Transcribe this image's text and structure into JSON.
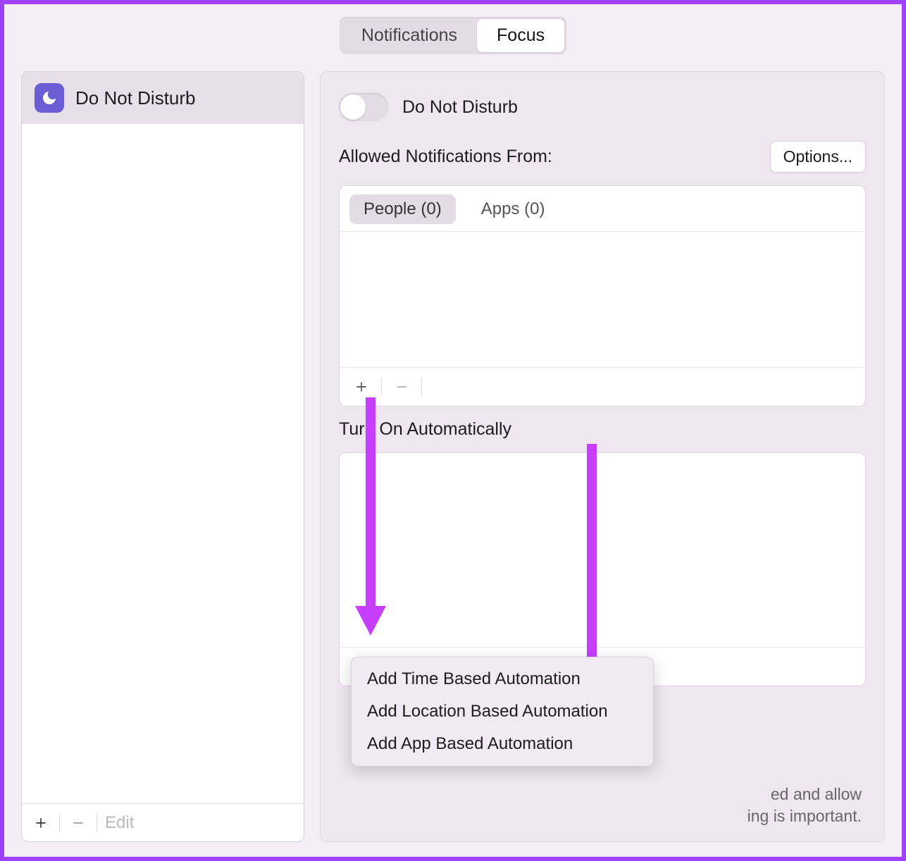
{
  "tabs": {
    "notifications": "Notifications",
    "focus": "Focus"
  },
  "sidebar": {
    "items": [
      {
        "label": "Do Not Disturb"
      }
    ],
    "edit": "Edit"
  },
  "main": {
    "dnd_label": "Do Not Disturb",
    "allowed": {
      "title": "Allowed Notifications From:",
      "options_btn": "Options...",
      "tabs": {
        "people": "People (0)",
        "apps": "Apps (0)"
      }
    },
    "auto": {
      "title": "Turn On Automatically"
    },
    "footer_hint_1": "ed and allow",
    "footer_hint_2": "ing is important.",
    "popup": {
      "time": "Add Time Based Automation",
      "location": "Add Location Based Automation",
      "app": "Add App Based Automation"
    }
  }
}
